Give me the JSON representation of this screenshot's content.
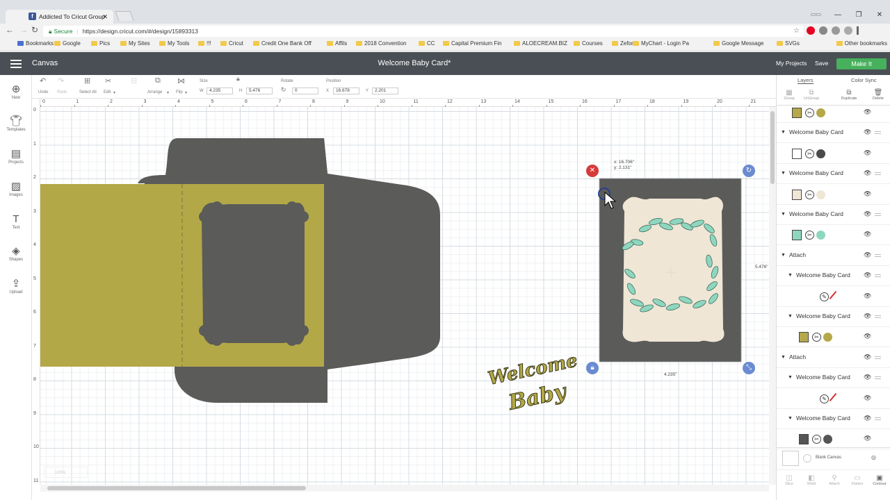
{
  "browser": {
    "tab_title": "Addicted To Cricut Group",
    "url": "https://design.cricut.com/#/design/15893313",
    "secure_label": "Secure",
    "bookmarks": [
      "Bookmarks",
      "Google",
      "Pics",
      "My Sites",
      "My Tools",
      "!!!",
      "Cricut",
      "Credit One Bank Off",
      "Affils",
      "2018 Convention",
      "CC",
      "Capital Premium Fin",
      "ALOECREAM.BIZ",
      "Courses",
      "Zefon",
      "MyChart - Login Pa",
      "Google Message",
      "SVGs"
    ],
    "other_bookmarks": "Other bookmarks"
  },
  "app": {
    "section": "Canvas",
    "title": "Welcome Baby Card*",
    "my_projects": "My Projects",
    "save": "Save",
    "make_it": "Make It"
  },
  "left_toolbar": [
    {
      "icon": "plus-circle-icon",
      "label": "New"
    },
    {
      "icon": "shirt-icon",
      "label": "Templates"
    },
    {
      "icon": "projects-icon",
      "label": "Projects"
    },
    {
      "icon": "images-icon",
      "label": "Images"
    },
    {
      "icon": "text-icon",
      "label": "Text"
    },
    {
      "icon": "shapes-icon",
      "label": "Shapes"
    },
    {
      "icon": "upload-icon",
      "label": "Upload"
    }
  ],
  "edit_toolbar": {
    "undo": "Undo",
    "redo": "Redo",
    "select_all": "Select All",
    "edit": "Edit",
    "arrange": "Arrange",
    "flip": "Flip",
    "size_label": "Size",
    "w_label": "W",
    "w_value": "4.235",
    "h_label": "H",
    "h_value": "5.476",
    "rotate_label": "Rotate",
    "rotate_value": "0",
    "position_label": "Position",
    "x_label": "X",
    "x_value": "16.678",
    "y_label": "Y",
    "y_value": "2.201"
  },
  "ruler": {
    "h": [
      "0",
      "1",
      "2",
      "3",
      "4",
      "5",
      "6",
      "7",
      "8",
      "9",
      "10",
      "11",
      "12",
      "13",
      "14",
      "15",
      "16",
      "17",
      "18",
      "19",
      "20",
      "21"
    ],
    "v": [
      "0",
      "1",
      "2",
      "3",
      "4",
      "5",
      "6",
      "7",
      "8",
      "9",
      "10",
      "11"
    ]
  },
  "canvas": {
    "coords_x": "x: 16.706\"",
    "coords_y": "y: 2.131\"",
    "width_label": "4.235\"",
    "height_label": "5.476\"",
    "zoom": "100%",
    "welcome_text": "Welcome",
    "baby_text": "Baby"
  },
  "layers_panel": {
    "tab_layers": "Layers",
    "tab_color_sync": "Color Sync",
    "actions": [
      "Group",
      "UnGroup",
      "Duplicate",
      "Delete"
    ],
    "rows": [
      {
        "type": "item",
        "indent": 0,
        "colors": [
          "#b5a84a",
          "#b5a84a"
        ],
        "top": true
      },
      {
        "type": "group",
        "name": "Welcome Baby Card",
        "indent": 0
      },
      {
        "type": "item",
        "indent": 0,
        "colors": [
          "#ffffff",
          "#4a4a4a"
        ]
      },
      {
        "type": "group",
        "name": "Welcome Baby Card",
        "indent": 0
      },
      {
        "type": "item",
        "indent": 0,
        "colors": [
          "#efe6d6",
          "#efe6d6"
        ]
      },
      {
        "type": "group",
        "name": "Welcome Baby Card",
        "indent": 0
      },
      {
        "type": "item",
        "indent": 0,
        "colors": [
          "#8fd6bf",
          "#8fd6bf"
        ]
      },
      {
        "type": "group",
        "name": "Attach",
        "indent": 0
      },
      {
        "type": "group",
        "name": "Welcome Baby Card",
        "indent": 1
      },
      {
        "type": "pen",
        "indent": 1,
        "colors": [
          "#d62b2b"
        ]
      },
      {
        "type": "group",
        "name": "Welcome Baby Card",
        "indent": 1
      },
      {
        "type": "item",
        "indent": 1,
        "colors": [
          "#b5a84a",
          "#b5a84a"
        ]
      },
      {
        "type": "group",
        "name": "Attach",
        "indent": 0
      },
      {
        "type": "group",
        "name": "Welcome Baby Card",
        "indent": 1
      },
      {
        "type": "pen",
        "indent": 1,
        "colors": [
          "#d62b2b"
        ]
      },
      {
        "type": "group",
        "name": "Welcome Baby Card",
        "indent": 1
      },
      {
        "type": "item",
        "indent": 1,
        "colors": [
          "#555555",
          "#555555"
        ]
      }
    ],
    "blank_canvas": "Blank Canvas",
    "footer": [
      "Slice",
      "Weld",
      "Attach",
      "Flatten",
      "Contour"
    ]
  },
  "colors": {
    "accent": "#47b05c",
    "header": "#4a4f55",
    "card_dark": "#5b5b59",
    "card_olive": "#b3a848",
    "cream": "#efe6d6",
    "leaf": "#8fd6bf",
    "delete_red": "#d63b3b",
    "handle_blue": "#6a8bd1"
  }
}
